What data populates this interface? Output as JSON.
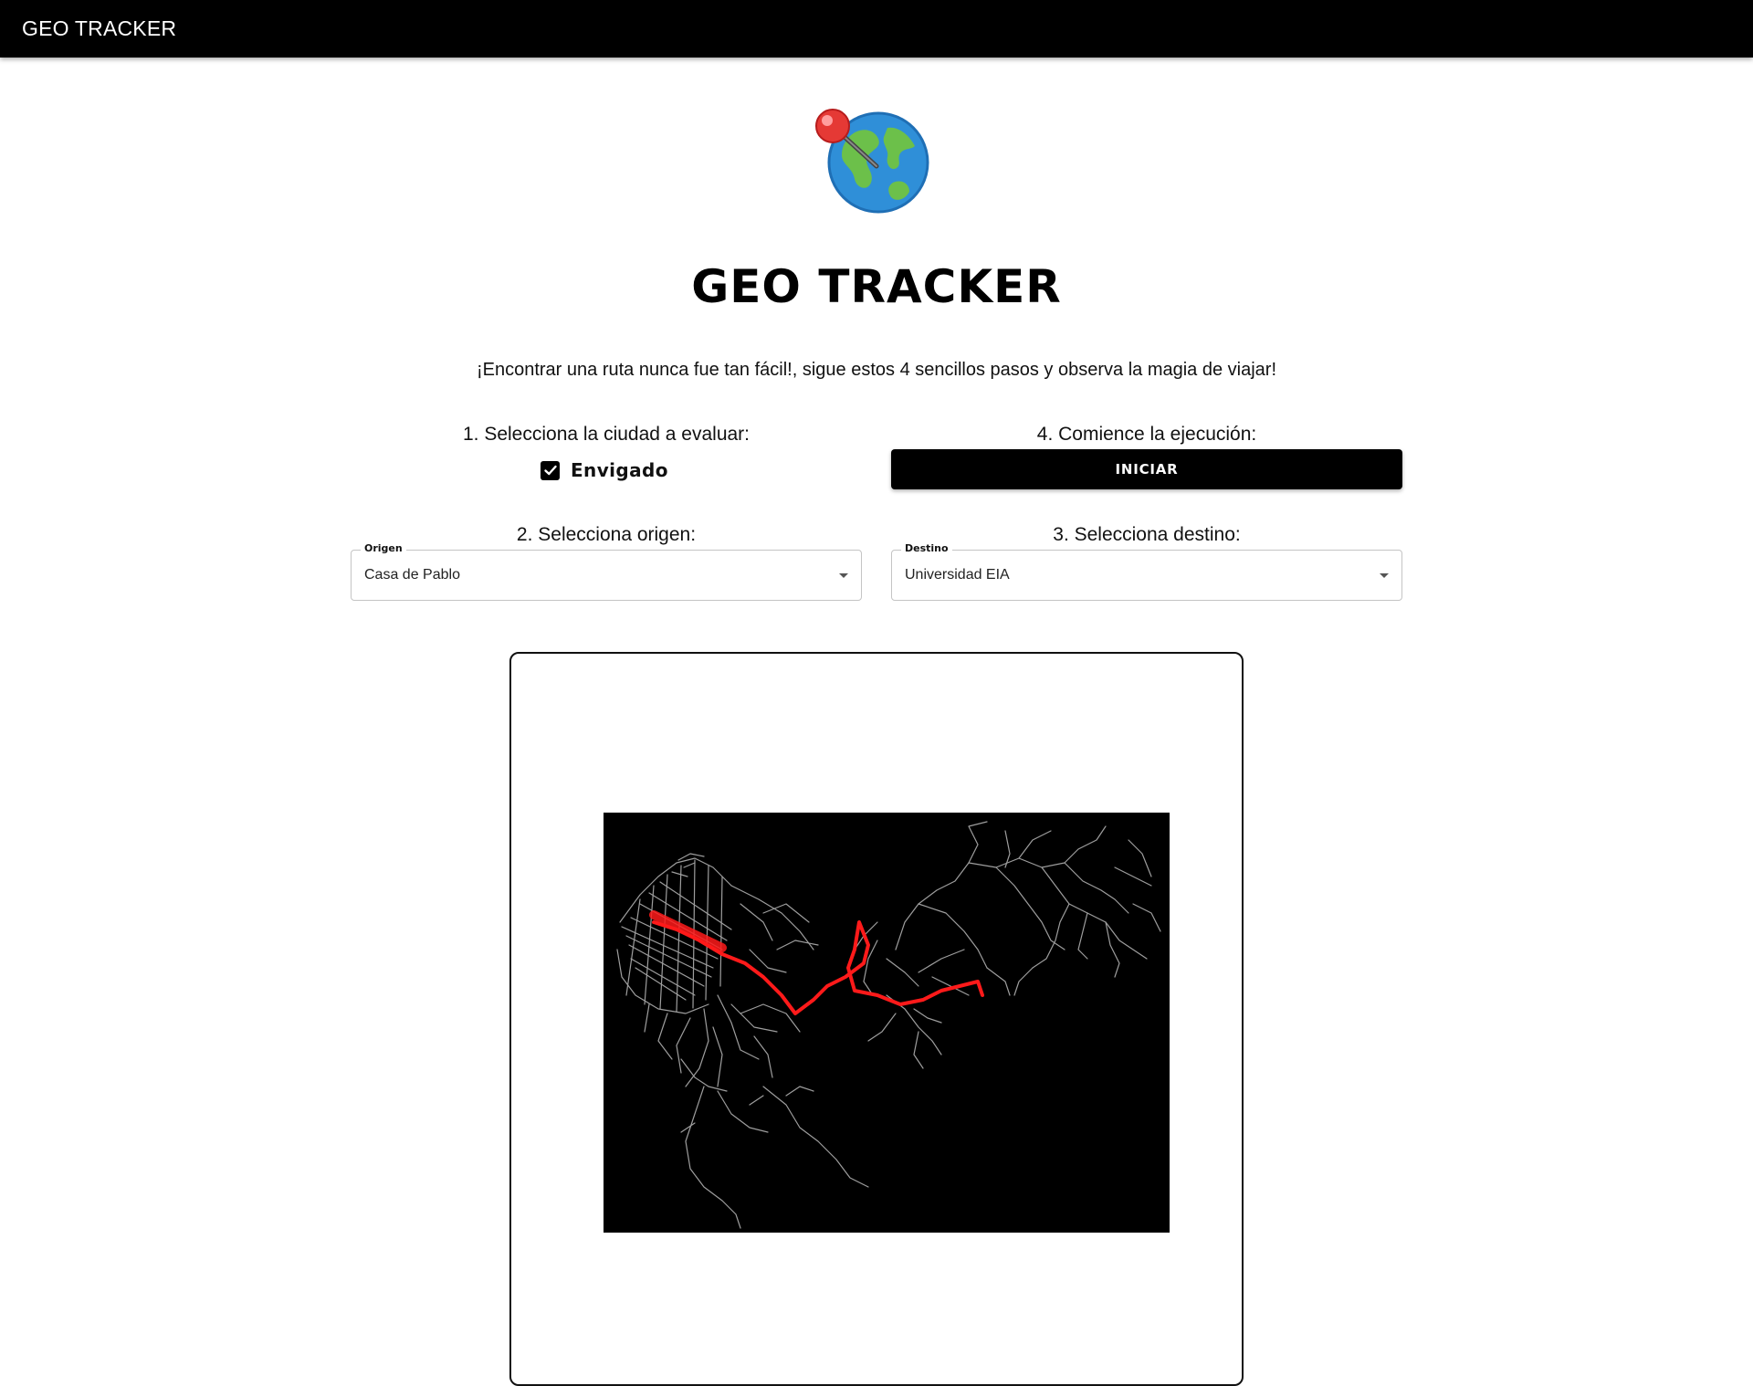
{
  "appbar": {
    "title": "GEO TRACKER"
  },
  "hero": {
    "title": "GEO TRACKER",
    "tagline": "¡Encontrar una ruta nunca fue tan fácil!, sigue estos 4 sencillos pasos y observa la magia de viajar!"
  },
  "steps": {
    "city": {
      "label": "1. Selecciona la ciudad a evaluar:",
      "option": "Envigado",
      "checked": true
    },
    "origin": {
      "label": "2. Selecciona origen:",
      "field_label": "Origen",
      "value": "Casa de Pablo"
    },
    "destination": {
      "label": "3. Selecciona destino:",
      "field_label": "Destino",
      "value": "Universidad EIA"
    },
    "start": {
      "label": "4. Comience la ejecución:",
      "button": "INICIAR"
    }
  },
  "icons": {
    "logo": "globe-with-pin-icon",
    "checkbox": "check-icon",
    "dropdown": "caret-down-icon"
  },
  "colors": {
    "appbar": "#000000",
    "button": "#000000",
    "map_background": "#000000",
    "road_network": "#9e9e9e",
    "route": "#ff1a1a"
  }
}
